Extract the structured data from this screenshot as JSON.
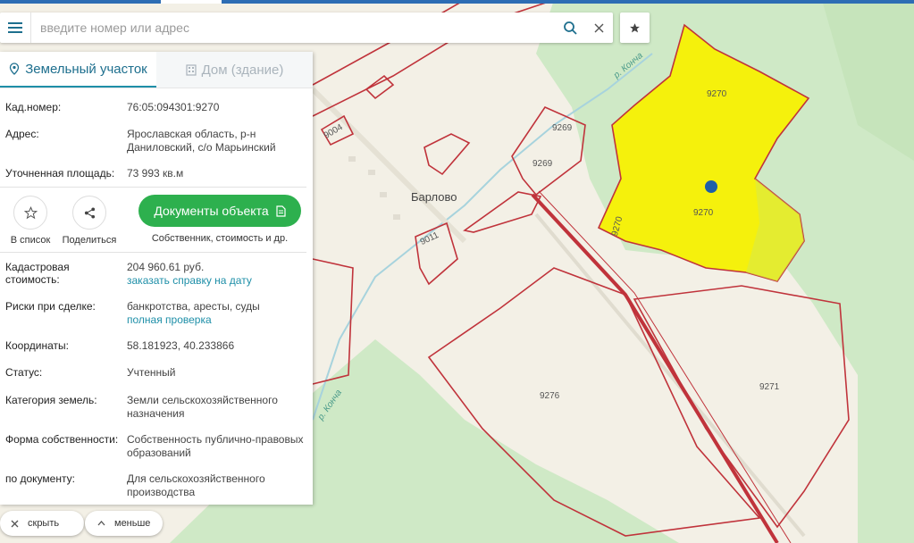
{
  "search": {
    "placeholder": "введите номер или адрес"
  },
  "tabs": [
    {
      "label": "Земельный участок"
    },
    {
      "label": "Дом (здание)"
    }
  ],
  "info": {
    "cad_label": "Кад.номер:",
    "cad_value": "76:05:094301:9270",
    "addr_label": "Адрес:",
    "addr_value": "Ярославская область, р-н Даниловский, с/о Марьинский",
    "area_label": "Уточненная площадь:",
    "area_value": "73 993 кв.м"
  },
  "actions": {
    "list_label": "В список",
    "share_label": "Поделиться",
    "docs_button": "Документы объекта",
    "docs_sub": "Собственник, стоимость и др."
  },
  "details": {
    "cost_label": "Кадастровая стоимость:",
    "cost_value": "204 960.61 руб.",
    "cost_link": "заказать справку на дату",
    "risk_label": "Риски при сделке:",
    "risk_value": "банкротства, аресты, суды",
    "risk_link": "полная проверка",
    "coord_label": "Координаты:",
    "coord_value": "58.181923, 40.233866",
    "status_label": "Статус:",
    "status_value": "Учтенный",
    "cat_label": "Категория земель:",
    "cat_value": "Земли сельскохозяйственного назначения",
    "own_label": "Форма собственности:",
    "own_value": "Собственность публично-правовых образований",
    "doc_label": "по документу:",
    "doc_value": "Для сельскохозяйственного производства"
  },
  "bottom": {
    "hide_label": "скрыть",
    "less_label": "меньше"
  },
  "map": {
    "place": "Барлово",
    "river_top": "р. Конча",
    "river_bottom": "р. Конча",
    "parcels": {
      "p9270a": "9270",
      "p9270b": "9270",
      "p9270c": "9270",
      "p9269a": "9269",
      "p9269b": "9269",
      "p9004": "9004",
      "p9011": "9011",
      "p9276": "9276",
      "p9271": "9271"
    }
  },
  "colors": {
    "accent": "#1e8fa8",
    "button": "#2db04e",
    "selection_fill": "#f5f10c",
    "parcel_border": "#c0333b",
    "forest": "#cfe9c6"
  }
}
